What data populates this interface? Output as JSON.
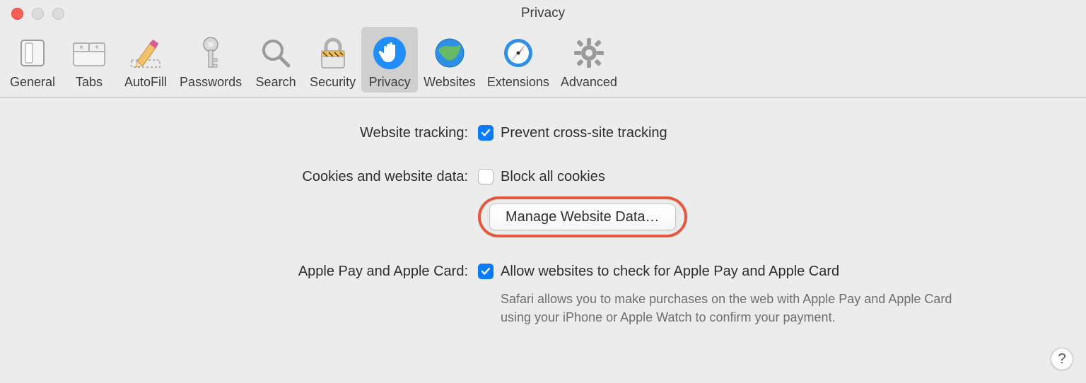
{
  "window": {
    "title": "Privacy"
  },
  "toolbar": {
    "items": [
      {
        "label": "General",
        "icon": "general"
      },
      {
        "label": "Tabs",
        "icon": "tabs"
      },
      {
        "label": "AutoFill",
        "icon": "autofill"
      },
      {
        "label": "Passwords",
        "icon": "passwords"
      },
      {
        "label": "Search",
        "icon": "search"
      },
      {
        "label": "Security",
        "icon": "security"
      },
      {
        "label": "Privacy",
        "icon": "privacy",
        "selected": true
      },
      {
        "label": "Websites",
        "icon": "websites"
      },
      {
        "label": "Extensions",
        "icon": "extensions"
      },
      {
        "label": "Advanced",
        "icon": "advanced"
      }
    ]
  },
  "sections": {
    "tracking": {
      "label": "Website tracking:",
      "checkbox_label": "Prevent cross-site tracking",
      "checked": true
    },
    "cookies": {
      "label": "Cookies and website data:",
      "checkbox_label": "Block all cookies",
      "checked": false,
      "button_label": "Manage Website Data…"
    },
    "applepay": {
      "label": "Apple Pay and Apple Card:",
      "checkbox_label": "Allow websites to check for Apple Pay and Apple Card",
      "checked": true,
      "description": "Safari allows you to make purchases on the web with Apple Pay and Apple Card using your iPhone or Apple Watch to confirm your payment."
    }
  },
  "help_label": "?"
}
